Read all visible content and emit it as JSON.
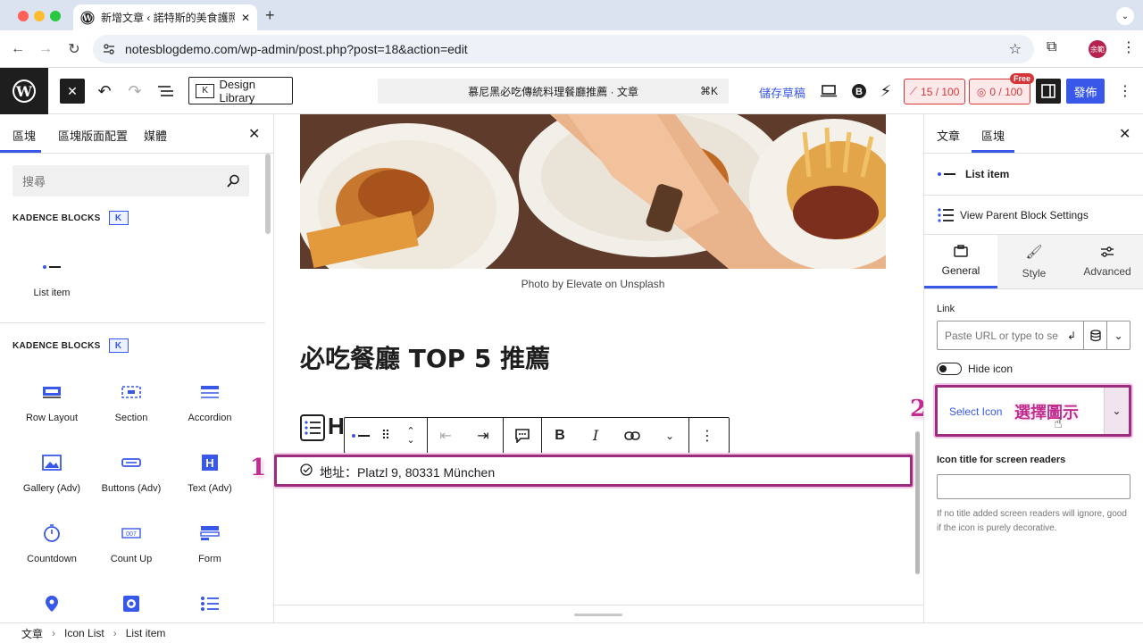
{
  "browser": {
    "tab_title": "新增文章 ‹ 諾特斯的美食護照 —",
    "url": "notesblogdemo.com/wp-admin/post.php?post=18&action=edit",
    "profile": "余範"
  },
  "toolbar": {
    "design_library_label": "Design Library",
    "command_title": "慕尼黑必吃傳統料理餐廳推薦 · 文章",
    "command_shortcut": "⌘K",
    "save_draft_label": "儲存草稿",
    "score_a": "15 / 100",
    "score_b": "0 / 100",
    "free_badge": "Free",
    "publish_label": "發佈"
  },
  "inserter": {
    "tabs": [
      "區塊",
      "區塊版面配置",
      "媒體"
    ],
    "search_placeholder": "搜尋",
    "category1": "KADENCE BLOCKS",
    "list_item_label": "List item",
    "category2": "KADENCE BLOCKS",
    "blocks": [
      {
        "label": "Row Layout",
        "icon": "row-layout-icon"
      },
      {
        "label": "Section",
        "icon": "section-icon"
      },
      {
        "label": "Accordion",
        "icon": "accordion-icon"
      },
      {
        "label": "Gallery (Adv)",
        "icon": "gallery-icon"
      },
      {
        "label": "Buttons (Adv)",
        "icon": "buttons-icon"
      },
      {
        "label": "Text (Adv)",
        "icon": "text-icon"
      },
      {
        "label": "Countdown",
        "icon": "countdown-icon"
      },
      {
        "label": "Count Up",
        "icon": "countup-icon"
      },
      {
        "label": "Form",
        "icon": "form-icon"
      },
      {
        "label": "",
        "icon": "map-pin-icon"
      },
      {
        "label": "",
        "icon": "star-box-icon"
      },
      {
        "label": "",
        "icon": "icon-list-icon"
      }
    ]
  },
  "content": {
    "caption": "Photo by Elevate on Unsplash",
    "heading": "必吃餐廳 TOP 5 推薦",
    "partial_heading_letter": "H",
    "list_item_text": "地址：Platzl 9, 80331 München",
    "marker1": "1",
    "marker2": "2"
  },
  "settings": {
    "tabs": [
      "文章",
      "區塊"
    ],
    "block_name": "List item",
    "parent_settings": "View Parent Block Settings",
    "panel_tabs": [
      "General",
      "Style",
      "Advanced"
    ],
    "link_label": "Link",
    "link_placeholder": "Paste URL or type to se",
    "hide_icon_label": "Hide icon",
    "select_icon_label": "Select Icon",
    "select_icon_note": "選擇圖示",
    "icon_title_label": "Icon title for screen readers",
    "help_text": "If no title added screen readers will ignore, good if the icon is purely decorative."
  },
  "breadcrumb": [
    "文章",
    "Icon List",
    "List item"
  ],
  "colors": {
    "accent": "#3858e9",
    "highlight": "#9c2c7e",
    "alert": "#d63638"
  }
}
